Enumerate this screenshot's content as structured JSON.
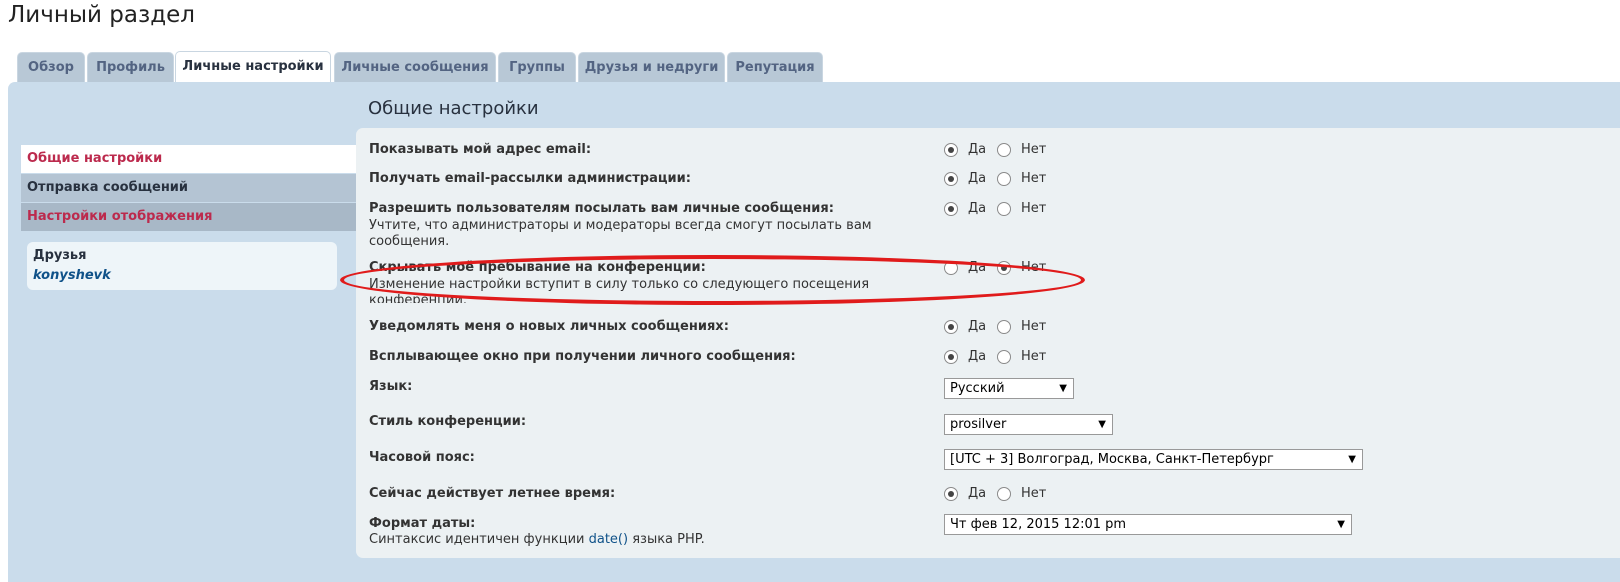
{
  "page_title": "Личный раздел",
  "tabs": [
    {
      "label": "Обзор"
    },
    {
      "label": "Профиль"
    },
    {
      "label": "Личные настройки"
    },
    {
      "label": "Личные сообщения"
    },
    {
      "label": "Группы"
    },
    {
      "label": "Друзья и недруги"
    },
    {
      "label": "Репутация"
    }
  ],
  "side_nav": [
    {
      "label": "Общие настройки"
    },
    {
      "label": "Отправка сообщений"
    },
    {
      "label": "Настройки отображения"
    }
  ],
  "friends": {
    "title": "Друзья",
    "items": [
      "konyshevk"
    ]
  },
  "content_title": "Общие настройки",
  "settings": {
    "show_email": {
      "label": "Показывать мой адрес email:",
      "yes": "Да",
      "no": "Нет",
      "value": "yes"
    },
    "admin_emails": {
      "label": "Получать email-рассылки администрации:",
      "yes": "Да",
      "no": "Нет",
      "value": "yes"
    },
    "allow_pm": {
      "label": "Разрешить пользователям посылать вам личные сообщения:",
      "note_line1": "Учтите, что администраторы и модераторы всегда смогут посылать вам",
      "note_line2": "сообщения.",
      "yes": "Да",
      "no": "Нет",
      "value": "yes"
    },
    "hide_online": {
      "label": "Скрывать моё пребывание на конференции:",
      "note_line1": "Изменение настройки вступит в силу только со следующего посещения",
      "note_line2": "конференции.",
      "yes": "Да",
      "no": "Нет",
      "value": "no"
    },
    "notify_pm": {
      "label": "Уведомлять меня о новых личных сообщениях:",
      "yes": "Да",
      "no": "Нет",
      "value": "yes"
    },
    "popup_pm": {
      "label": "Всплывающее окно при получении личного сообщения:",
      "yes": "Да",
      "no": "Нет",
      "value": "yes"
    },
    "language": {
      "label": "Язык:",
      "value": "Русский"
    },
    "style": {
      "label": "Стиль конференции:",
      "value": "prosilver"
    },
    "timezone": {
      "label": "Часовой пояс:",
      "value": "[UTC + 3] Волгоград, Москва, Санкт-Петербург"
    },
    "dst": {
      "label": "Сейчас действует летнее время:",
      "yes": "Да",
      "no": "Нет",
      "value": "yes"
    },
    "date_format": {
      "label": "Формат даты:",
      "value": "Чт фев 12, 2015 12:01 pm",
      "note_prefix": "Синтаксис идентичен функции ",
      "note_link": "date()",
      "note_suffix": " языка PHP."
    }
  },
  "colors": {
    "panel": "#cadceb",
    "content": "#ecf1f3",
    "active_link": "#bc2a4d",
    "annotation": "#e01b1b"
  }
}
